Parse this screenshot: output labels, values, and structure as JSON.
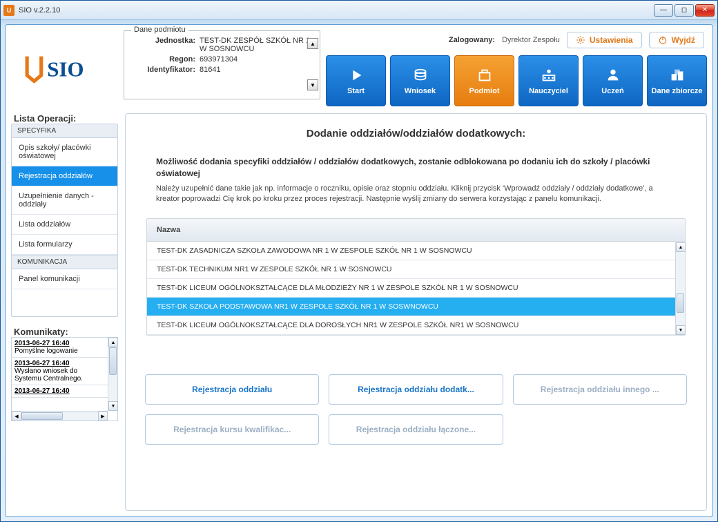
{
  "window": {
    "title": "SIO v.2.2.10"
  },
  "entity": {
    "legend": "Dane podmiotu",
    "labels": {
      "unit": "Jednostka:",
      "regon": "Regon:",
      "id": "Identyfikator:"
    },
    "values": {
      "unit": "TEST-DK ZESPÓŁ SZKÓŁ NR 1 W SOSNOWCU",
      "regon": "693971304",
      "id": "81641"
    }
  },
  "user": {
    "label": "Zalogowany:",
    "name": "Dyrektor Zespołu"
  },
  "header_buttons": {
    "settings": "Ustawienia",
    "logout": "Wyjdź"
  },
  "nav": [
    {
      "key": "start",
      "label": "Start"
    },
    {
      "key": "wniosek",
      "label": "Wniosek"
    },
    {
      "key": "podmiot",
      "label": "Podmiot",
      "active": true
    },
    {
      "key": "nauczyciel",
      "label": "Nauczyciel"
    },
    {
      "key": "uczen",
      "label": "Uczeń"
    },
    {
      "key": "danezbiorcze",
      "label": "Dane zbiorcze"
    }
  ],
  "ops": {
    "title": "Lista Operacji:",
    "sections": [
      {
        "name": "SPECYFIKA",
        "items": [
          {
            "label": "Opis szkoły/ placówki oświatowej"
          },
          {
            "label": "Rejestracja oddziałów",
            "selected": true
          },
          {
            "label": "Uzupełnienie danych - oddziały"
          },
          {
            "label": "Lista oddziałów"
          },
          {
            "label": "Lista formularzy"
          }
        ]
      },
      {
        "name": "KOMUNIKACJA",
        "items": [
          {
            "label": "Panel komunikacji"
          }
        ]
      }
    ]
  },
  "messages": {
    "title": "Komunikaty:",
    "items": [
      {
        "ts": "2013-06-27 16:40",
        "text": "Pomyślne logowanie"
      },
      {
        "ts": "2013-06-27 16:40",
        "text": "Wysłano wniosek do Systemu Centralnego."
      },
      {
        "ts": "2013-06-27 16:40",
        "text": ""
      }
    ]
  },
  "main": {
    "title": "Dodanie oddziałów/oddziałów dodatkowych:",
    "intro_head": "Możliwość dodania specyfiki oddziałów / oddziałów dodatkowych, zostanie odblokowana po dodaniu ich do szkoły / placówki oświatowej",
    "intro_body": "Należy uzupełnić dane takie jak np. informacje o roczniku, opisie oraz stopniu oddziału. Kliknij przycisk 'Wprowadź oddziały / oddziały dodatkowe', a kreator poprowadzi Cię krok po kroku przez proces rejestracji. Następnie wyślij zmiany do serwera korzystając z panelu komunikacji.",
    "table_header": "Nazwa",
    "rows": [
      {
        "label": "TEST-DK ZASADNICZA SZKOŁA ZAWODOWA NR 1 W ZESPOLE SZKÓŁ NR 1 W SOSNOWCU"
      },
      {
        "label": "TEST-DK TECHNIKUM NR1 W ZESPOLE SZKÓŁ NR 1 W SOSNOWCU"
      },
      {
        "label": "TEST-DK LICEUM OGÓLNOKSZTAŁCĄCE DLA MŁODZIEŻY NR 1 W ZESPOLE SZKÓŁ NR 1 W SOSNOWCU"
      },
      {
        "label": "TEST-DK SZKOŁA PODSTAWOWA NR1 W ZESPOLE SZKÓŁ NR 1 W SOSWNOWCU",
        "selected": true
      },
      {
        "label": "TEST-DK LICEUM OGÓLNOKSZTAŁCĄCE DLA DOROSŁYCH NR1 W ZESPOLE SZKÓŁ NR1 W SOSNOWCU"
      }
    ],
    "actions": [
      {
        "label": "Rejestracja oddziału"
      },
      {
        "label": "Rejestracja oddziału dodatk..."
      },
      {
        "label": "Rejestracja oddziału innego ...",
        "disabled": true
      },
      {
        "label": "Rejestracja kursu kwalifikac...",
        "disabled": true
      },
      {
        "label": "Rejestracja oddziału łączone...",
        "disabled": true
      }
    ]
  }
}
